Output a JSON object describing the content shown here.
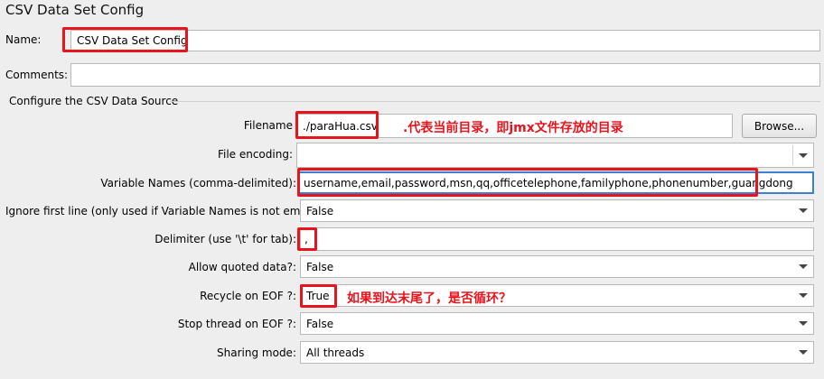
{
  "panel": {
    "title": "CSV Data Set Config"
  },
  "name": {
    "label": "Name:",
    "value": "CSV Data Set Config"
  },
  "comments": {
    "label": "Comments:",
    "value": ""
  },
  "section": {
    "title": "Configure the CSV Data Source"
  },
  "filename": {
    "label": "Filename",
    "value": "./paraHua.csv",
    "browse_label": "Browse..."
  },
  "file_encoding": {
    "label": "File encoding:",
    "value": ""
  },
  "variable_names": {
    "label": "Variable Names (comma-delimited):",
    "value": "username,email,password,msn,qq,officetelephone,familyphone,phonenumber,guangdong"
  },
  "ignore_first_line": {
    "label": "Ignore first line (only used if Variable Names is not empty):",
    "value": "False"
  },
  "delimiter": {
    "label": "Delimiter (use '\\t' for tab):",
    "value": ","
  },
  "allow_quoted": {
    "label": "Allow quoted data?:",
    "value": "False"
  },
  "recycle_eof": {
    "label": "Recycle on EOF ?:",
    "value": "True"
  },
  "stop_thread_eof": {
    "label": "Stop thread on EOF ?:",
    "value": "False"
  },
  "sharing_mode": {
    "label": "Sharing mode:",
    "value": "All threads"
  },
  "annotations": {
    "filename_note": ".代表当前目录，即jmx文件存放的目录",
    "recycle_note": "如果到达末尾了，是否循环？"
  },
  "colors": {
    "highlight": "#e8141c",
    "background": "#eeeeee"
  },
  "icons": {
    "dropdown": "chevron-down-icon"
  }
}
